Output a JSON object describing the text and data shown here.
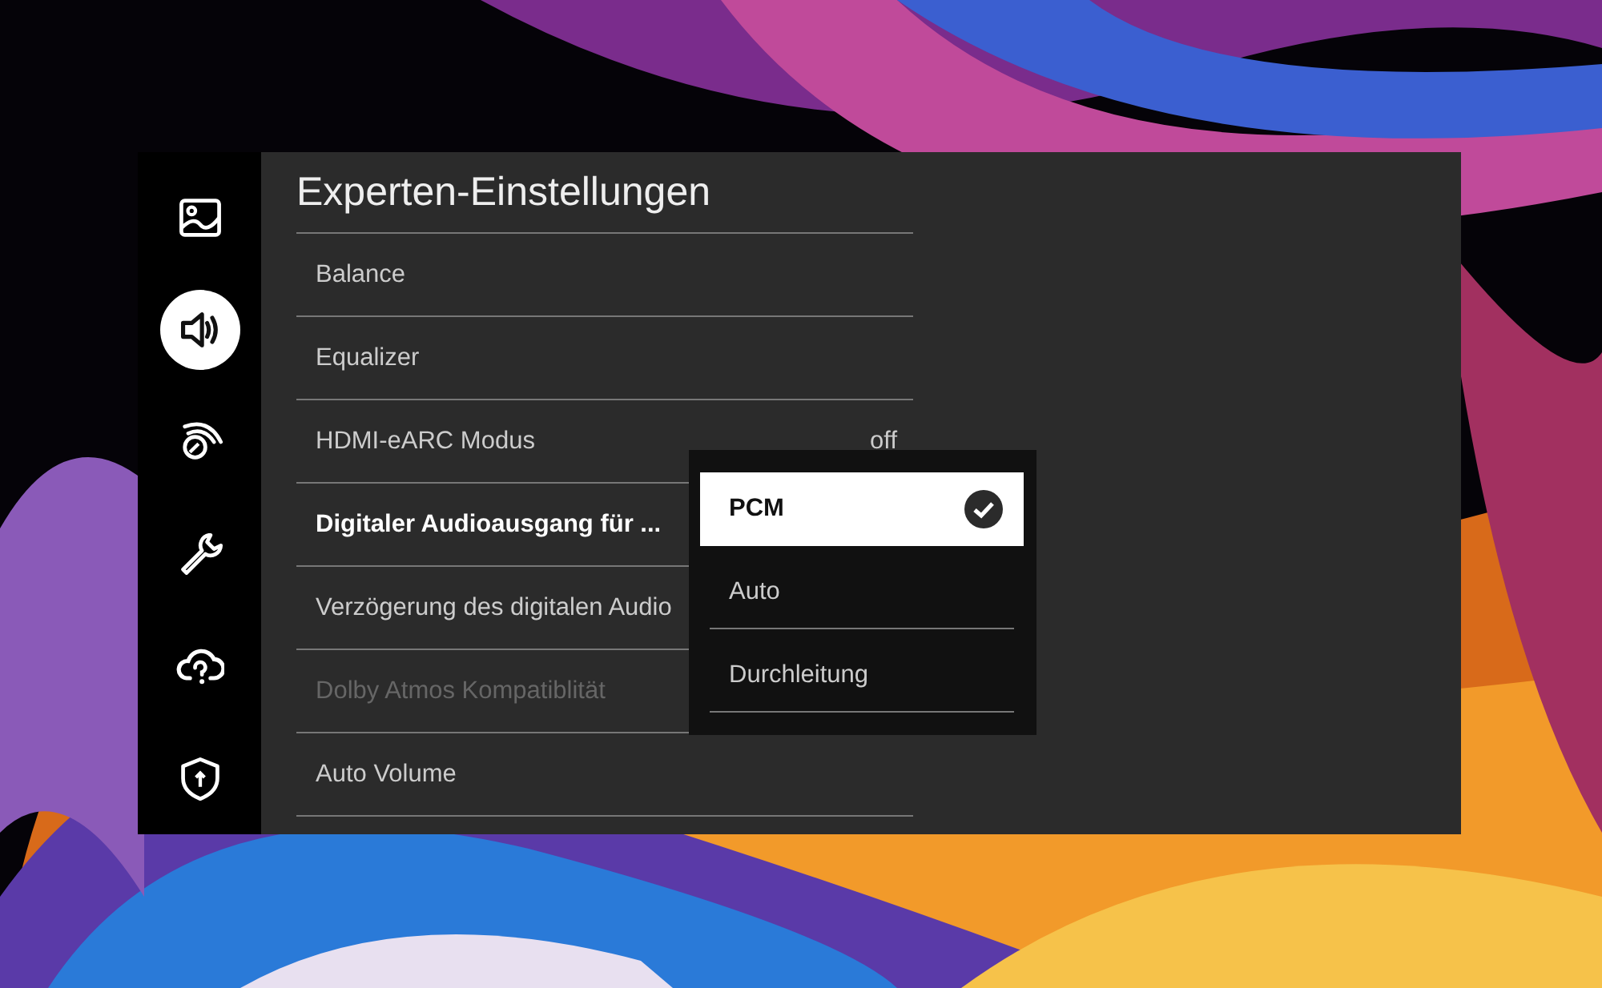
{
  "sidebar": {
    "items": [
      {
        "kind": "picture",
        "selected": false
      },
      {
        "kind": "sound",
        "selected": true
      },
      {
        "kind": "broadcast",
        "selected": false
      },
      {
        "kind": "tools",
        "selected": false
      },
      {
        "kind": "cloud",
        "selected": false
      },
      {
        "kind": "shield",
        "selected": false
      }
    ]
  },
  "panel": {
    "title": "Experten-Einstellungen",
    "items": [
      {
        "label": "Balance",
        "selected": false,
        "disabled": false
      },
      {
        "label": "Equalizer",
        "selected": false,
        "disabled": false
      },
      {
        "label": "HDMI-eARC Modus",
        "value": "off",
        "selected": false,
        "disabled": false
      },
      {
        "label": "Digitaler Audioausgang für ...",
        "selected": true,
        "disabled": false
      },
      {
        "label": "Verzögerung des digitalen Audio",
        "selected": false,
        "disabled": false
      },
      {
        "label": "Dolby Atmos Kompatiblität",
        "selected": false,
        "disabled": true
      },
      {
        "label": "Auto Volume",
        "selected": false,
        "disabled": false
      }
    ]
  },
  "dropdown": {
    "options": [
      {
        "label": "PCM",
        "selected": true
      },
      {
        "label": "Auto",
        "selected": false
      },
      {
        "label": "Durchleitung",
        "selected": false
      }
    ]
  }
}
